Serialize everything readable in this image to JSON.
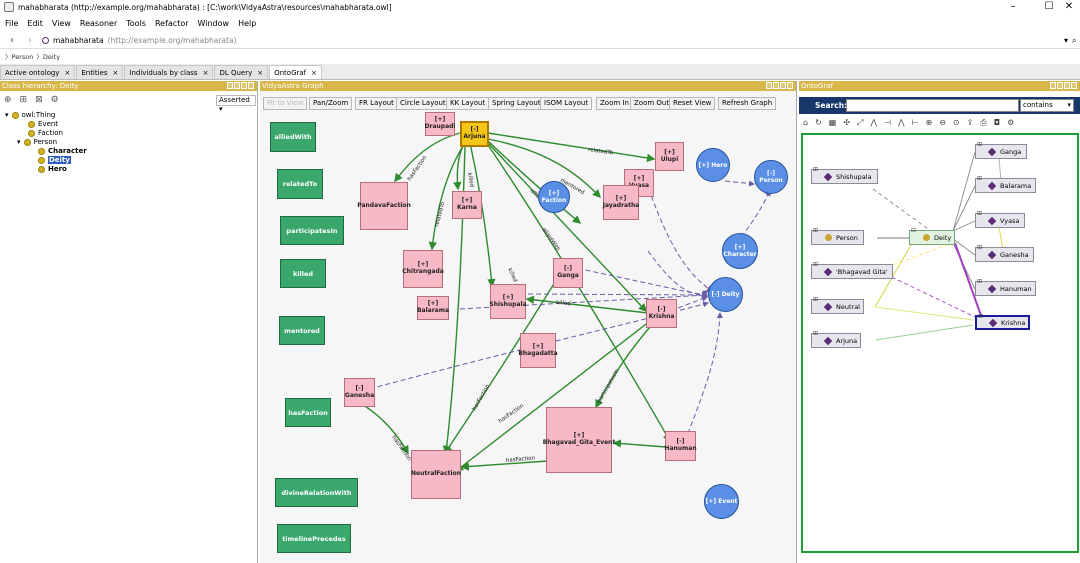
{
  "window": {
    "title": "mahabharata (http://example.org/mahabharata) : [C:\\work\\VidyaAstra\\resources\\mahabharata.owl]",
    "minimize": "–",
    "maximize": "☐",
    "close": "✕"
  },
  "menu": [
    "File",
    "Edit",
    "View",
    "Reasoner",
    "Tools",
    "Refactor",
    "Window",
    "Help"
  ],
  "address": {
    "ontology": "mahabharata",
    "iri": "(http://example.org/mahabharata)"
  },
  "breadcrumb": [
    "Person",
    "Deity"
  ],
  "tabs": [
    {
      "label": "Active ontology",
      "close": "×"
    },
    {
      "label": "Entities",
      "close": "×"
    },
    {
      "label": "Individuals by class",
      "close": "×"
    },
    {
      "label": "DL Query",
      "close": "×"
    },
    {
      "label": "OntoGraf",
      "close": "×"
    }
  ],
  "left_panel": {
    "header": "Class hierarchy: Deity",
    "asserted": "Asserted",
    "tree": [
      {
        "label": "owl:Thing",
        "level": 0,
        "toggle": "▾"
      },
      {
        "label": "Event",
        "level": 1
      },
      {
        "label": "Faction",
        "level": 1
      },
      {
        "label": "Person",
        "level": 1,
        "toggle": "▾"
      },
      {
        "label": "Character",
        "level": 2
      },
      {
        "label": "Deity",
        "level": 2,
        "selected": true
      },
      {
        "label": "Hero",
        "level": 2
      }
    ]
  },
  "graph_panel": {
    "header": "VidyaAstra Graph",
    "toolbar": [
      "Fit to View",
      "Pan/Zoom",
      "FR Layout",
      "Circle Layout",
      "KK Layout",
      "Spring Layout",
      "ISOM Layout",
      "Zoom In",
      "Zoom Out",
      "Reset View",
      "Refresh Graph"
    ],
    "properties": [
      "alliedWith",
      "relatedTo",
      "participatesIn",
      "killed",
      "mentored",
      "hasFaction",
      "divineRelationWith",
      "timelinePrecedes"
    ],
    "nodes": {
      "draupadi": "[+] Draupadi",
      "arjuna": "[-] Arjuna",
      "pandava": "PandavaFaction",
      "karna": "[+] Karna",
      "chitrangada": "[+] Chitrangada",
      "balarama": "[+] Balarama",
      "shishupala": "[+] Shishupala",
      "ganga": "[-] Ganga",
      "bhagadatta": "[+] Bhagadatta",
      "krishna": "[-] Krishna",
      "ganesha": "[-] Ganesha",
      "neutral": "NeutralFaction",
      "bhagavad": "[+] Bhagavad_Gita_Event",
      "hanuman": "[-] Hanuman",
      "ulupi": "[+] Ulupi",
      "vyasa": "[+] Vyasa",
      "jayadratha": "[+] Jayadratha",
      "faction": "[+] Faction",
      "hero": "[+] Hero",
      "person": "[-] Person",
      "character": "[+] Character",
      "deity": "[-] Deity",
      "event": "[+] Event"
    },
    "edge_labels": {
      "related_to": "relatedTo",
      "has_faction": "hasFaction",
      "killed": "killed",
      "allied_with": "alliedWith",
      "related_to_2": "relatedTo",
      "mentored": "mentored",
      "killed_2": "killed",
      "allied_with_2": "alliedWith",
      "killed_3": "killed",
      "participates_in": "participatesIn",
      "has_faction_2": "hasFaction",
      "has_faction_3": "hasFaction",
      "has_faction_4": "hasFaction",
      "has_faction_5": "hasFaction"
    }
  },
  "ontograf": {
    "header": "OntoGraf",
    "search_label": "Search:",
    "search_value": "",
    "match_mode": "contains",
    "nodes": {
      "shishupala": "Shishupala",
      "person": "Person",
      "bhagavad_gita": "'Bhagavad Gita'",
      "neutral": "Neutral",
      "arjuna": "Arjuna",
      "deity": "Deity",
      "ganga": "Ganga",
      "balarama": "Balarama",
      "vyasa": "Vyasa",
      "ganesha": "Ganesha",
      "hanuman": "Hanuman",
      "krishna": "Krishna"
    }
  },
  "colors": {
    "panel_header": "#d7b74a",
    "property_box": "#3aa76d",
    "individual_box": "#f7b9c6",
    "class_circle": "#5b8fe6",
    "selected_node": "#f5c518",
    "ontograf_bar": "#17376b"
  }
}
